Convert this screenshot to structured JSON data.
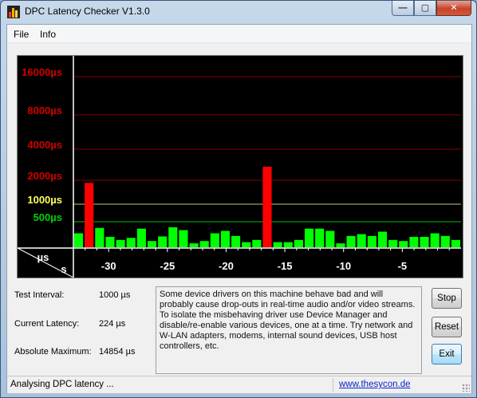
{
  "window": {
    "title": "DPC Latency Checker V1.3.0",
    "controls": {
      "minimize": "—",
      "maximize": "▢",
      "close": "✕"
    }
  },
  "menu": {
    "items": [
      "File",
      "Info"
    ]
  },
  "chart_data": {
    "type": "bar",
    "y_tick_labels": [
      "16000µs",
      "8000µs",
      "4000µs",
      "2000µs",
      "1000µs",
      "500µs"
    ],
    "y_ticks": [
      16000,
      8000,
      4000,
      2000,
      1000,
      500
    ],
    "y_unit_label": "µs",
    "x_unit_label": "s",
    "x_tick_labels": [
      "-30",
      "-25",
      "-20",
      "-15",
      "-10",
      "-5"
    ],
    "x_ticks": [
      -30,
      -25,
      -20,
      -15,
      -10,
      -5
    ],
    "xlim": [
      -33,
      0
    ],
    "y_scale": "log",
    "values": [
      330,
      1850,
      400,
      290,
      260,
      280,
      390,
      250,
      295,
      410,
      370,
      230,
      250,
      330,
      360,
      300,
      240,
      260,
      2700,
      240,
      240,
      260,
      390,
      390,
      360,
      230,
      300,
      320,
      300,
      350,
      260,
      250,
      290,
      290,
      330,
      300,
      260
    ],
    "high_threshold": 1000,
    "colors": {
      "normal": "#00ff00",
      "high": "#ff0000",
      "grid_red": "#8b0000",
      "grid_yellow": "#c8c870",
      "grid_green": "#00c000",
      "label_red": "#d20000",
      "label_yellow": "#ffff60",
      "label_green": "#00d000",
      "axis": "#ffffff"
    }
  },
  "stats": {
    "test_interval_label": "Test Interval:",
    "test_interval_value": "1000 µs",
    "current_latency_label": "Current Latency:",
    "current_latency_value": "224 µs",
    "absolute_max_label": "Absolute Maximum:",
    "absolute_max_value": "14854 µs"
  },
  "message": "Some device drivers on this machine behave bad and will probably cause drop-outs in real-time audio and/or video streams. To isolate the misbehaving driver use Device Manager and disable/re-enable various devices, one at a time. Try network and W-LAN adapters, modems, internal sound devices, USB host controllers, etc.",
  "buttons": {
    "stop": "Stop",
    "reset": "Reset",
    "exit": "Exit"
  },
  "status": {
    "text": "Analysing DPC latency ...",
    "link": "www.thesycon.de"
  }
}
